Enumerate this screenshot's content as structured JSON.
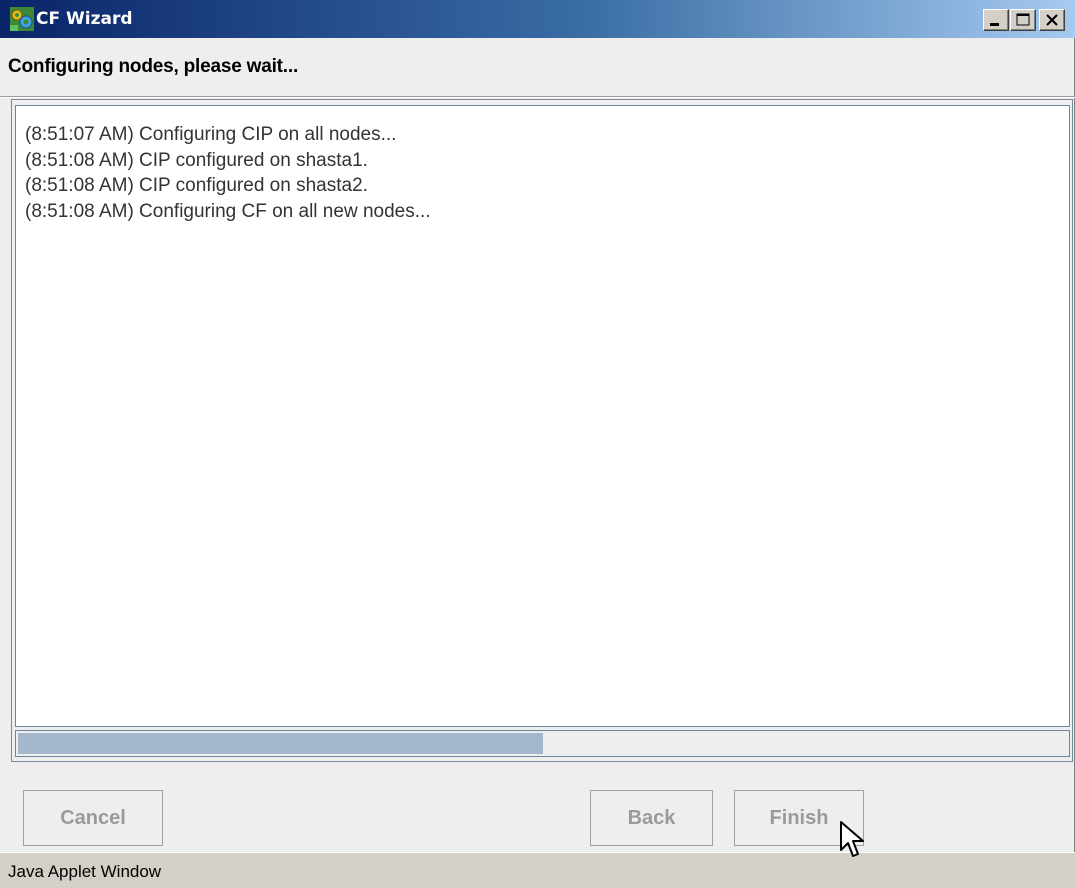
{
  "window": {
    "title": "CF Wizard",
    "icon": "cf-wizard-app-icon",
    "controls": [
      "minimize-icon",
      "maximize-icon",
      "close-icon"
    ]
  },
  "header": {
    "text": "Configuring nodes, please wait..."
  },
  "log": {
    "lines": [
      "(8:51:07 AM) Configuring CIP on all nodes...",
      "(8:51:08 AM) CIP configured on shasta1.",
      "(8:51:08 AM) CIP configured on shasta2.",
      "(8:51:08 AM) Configuring CF on all new nodes..."
    ]
  },
  "progress": {
    "value_percent": 50,
    "fill_color": "#a3b8cc"
  },
  "buttons": {
    "cancel": "Cancel",
    "back": "Back",
    "finish": "Finish"
  },
  "status_bar": {
    "text": "Java Applet Window"
  },
  "colors": {
    "titlebar_start": "#0a246a",
    "titlebar_end": "#a6caf0",
    "disabled_text": "#9a9a9a"
  }
}
